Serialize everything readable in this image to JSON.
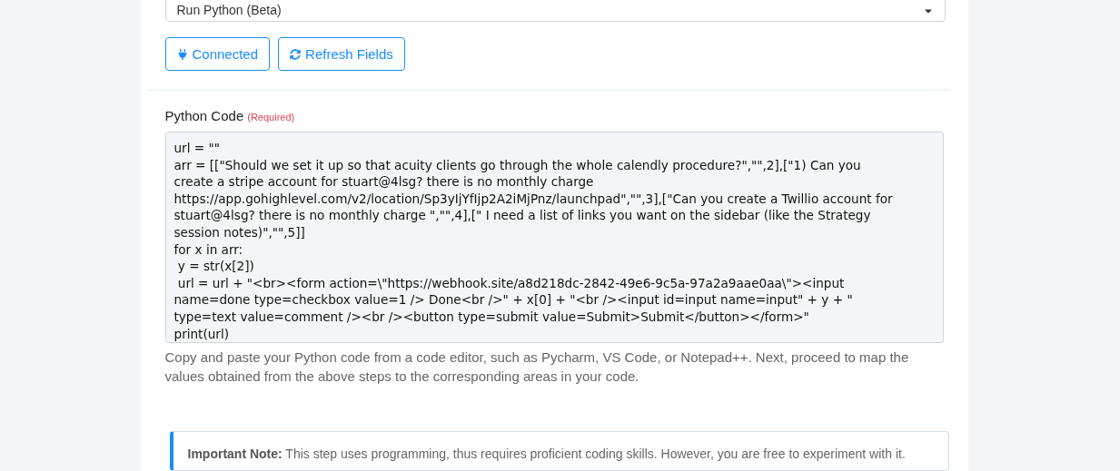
{
  "action_select": {
    "value": "Run Python (Beta)"
  },
  "buttons": [
    {
      "kind": "connected",
      "label": "Connected"
    },
    {
      "kind": "refresh",
      "label": "Refresh Fields"
    }
  ],
  "code_field": {
    "label": "Python Code",
    "required": "(Required)",
    "lines": [
      "url = \"\"",
      "arr = [[\"Should we set it up so that acuity clients go through the whole calendly procedure?\",\"\",2],[\"1) Can you",
      "create a stripe account for stuart@4lsg? there is no monthly charge",
      "https://app.gohighlevel.com/v2/location/Sp3yIjYfIjp2A2iMjPnz/launchpad\",\"\",3],[\"Can you create a Twillio account for",
      "stuart@4lsg? there is no monthly charge \",\"\",4],[\" I need a list of links you want on the sidebar (like the Strategy",
      "session notes)\",\"\",5]]",
      "for x in arr:",
      " y = str(x[2])",
      " url = url + \"<br><form action=\\\"https://webhook.site/a8d218dc-2842-49e6-9c5a-97a2a9aae0aa\\\"><input",
      "name=done type=checkbox value=1 /> Done<br />\" + x[0] + \"<br /><input id=input name=input\" + y + \"",
      "type=text value=comment /><br /><button type=submit value=Submit>Submit</button></form>\"",
      "print(url)"
    ],
    "help": "Copy and paste your Python code from a code editor, such as Pycharm, VS Code, or Notepad++. Next, proceed to map the values obtained from the above steps to the corresponding areas in your code."
  },
  "note": {
    "title": "Important Note:",
    "text": "This step uses programming, thus requires proficient coding skills. However, you are free to experiment with it."
  }
}
